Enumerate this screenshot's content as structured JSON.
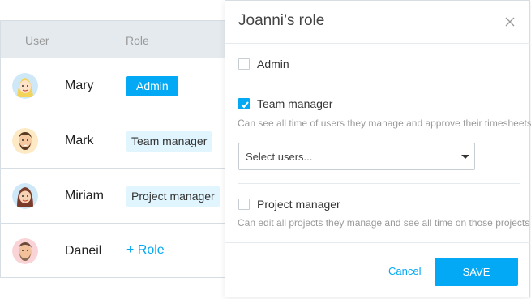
{
  "table": {
    "header_user": "User",
    "header_role": "Role",
    "rows": [
      {
        "name": "Mary",
        "role": "Admin",
        "avatar": "avatar-mary"
      },
      {
        "name": "Mark",
        "role": "Team manager",
        "avatar": "avatar-mark"
      },
      {
        "name": "Miriam",
        "role": "Project manager",
        "avatar": "avatar-miriam"
      },
      {
        "name": "Daneil",
        "add_role": "+ Role",
        "avatar": "avatar-daneil"
      }
    ]
  },
  "modal": {
    "title": "Joanni’s role",
    "options": [
      {
        "label": "Admin",
        "checked": false
      },
      {
        "label": "Team manager",
        "checked": true,
        "description": "Can see all time of users they manage and approve their timesheets"
      },
      {
        "label": "Project manager",
        "checked": false,
        "description": "Can edit all projects they manage and see all time on those projects"
      }
    ],
    "select_placeholder": "Select users...",
    "cancel_label": "Cancel",
    "save_label": "SAVE"
  },
  "colors": {
    "accent": "#03a9f4",
    "badge_light": "#e1f5fe",
    "header_bg": "#e4eaee"
  },
  "icons": [
    "close-icon",
    "checkmark-icon",
    "caret-down-icon"
  ]
}
